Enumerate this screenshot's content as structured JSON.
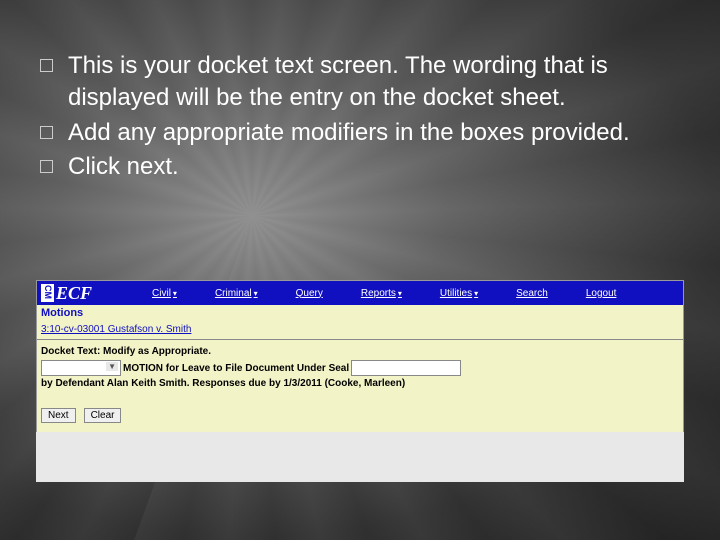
{
  "bullets": [
    "This is your docket text screen.   The wording that is displayed will be the entry on the docket sheet.",
    "Add any appropriate modifiers in the boxes provided.",
    "Click next."
  ],
  "app": {
    "logo_cm": "CM",
    "logo_ecf": "ECF",
    "menu": {
      "civil": "Civil",
      "criminal": "Criminal",
      "query": "Query",
      "reports": "Reports",
      "utilities": "Utilities",
      "search": "Search",
      "logout": "Logout"
    },
    "motions_title": "Motions",
    "case_link": "3:10-cv-03001 Gustafson v. Smith",
    "docket_label": "Docket Text: Modify as Appropriate.",
    "docket_text_1": "MOTION for Leave to File Document Under Seal",
    "docket_text_2": "by Defendant Alan Keith Smith. Responses due by 1/3/2011 (Cooke, Marleen)",
    "next_btn": "Next",
    "clear_btn": "Clear"
  }
}
